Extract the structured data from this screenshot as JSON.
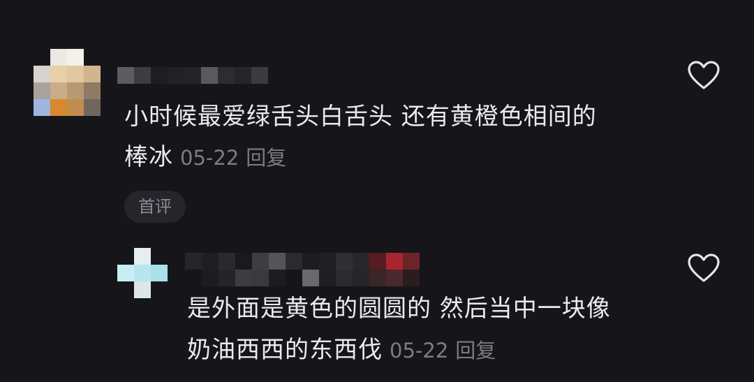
{
  "comment": {
    "text_line1": "小时候最爱绿舌头白舌头 还有黄橙色相间的",
    "text_line2": "棒冰",
    "date": "05-22",
    "reply_label": "回复",
    "badge": "首评",
    "like_icon": "heart-outline-icon"
  },
  "reply": {
    "text_line1": "是外面是黄色的圆圆的 然后当中一块像",
    "text_line2": "奶油西西的东西伐",
    "date": "05-22",
    "reply_label": "回复",
    "like_icon": "heart-outline-icon"
  },
  "colors": {
    "background": "#16151a",
    "text": "#ebebee",
    "meta": "#7c7c82",
    "badge_bg": "#26252b"
  }
}
